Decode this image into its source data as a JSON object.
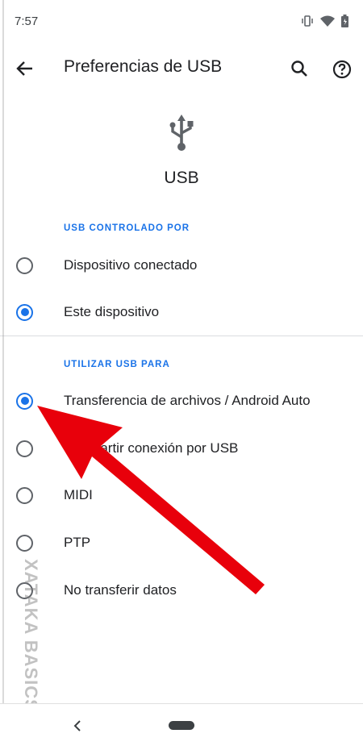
{
  "status_bar": {
    "time": "7:57"
  },
  "app_bar": {
    "title": "Preferencias de USB"
  },
  "header": {
    "label": "USB"
  },
  "controlled_by": {
    "title": "USB CONTROLADO POR",
    "options": [
      {
        "label": "Dispositivo conectado",
        "checked": false
      },
      {
        "label": "Este dispositivo",
        "checked": true
      }
    ]
  },
  "use_usb_for": {
    "title": "UTILIZAR USB PARA",
    "options": [
      {
        "label": "Transferencia de archivos / Android Auto",
        "checked": true
      },
      {
        "label": "Compartir conexión por USB",
        "checked": false
      },
      {
        "label": "MIDI",
        "checked": false
      },
      {
        "label": "PTP",
        "checked": false
      },
      {
        "label": "No transferir datos",
        "checked": false
      }
    ]
  },
  "watermark": {
    "text": "XATAKA BASICS"
  },
  "colors": {
    "accent": "#1a73e8",
    "arrow": "#e8000b"
  }
}
